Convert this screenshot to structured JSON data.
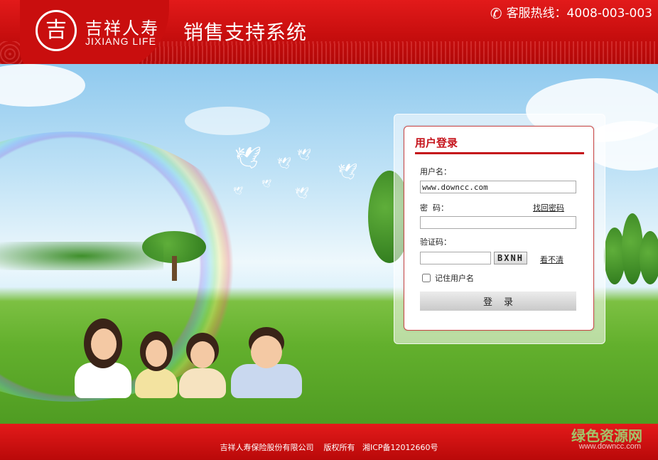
{
  "header": {
    "logo_glyph": "吉",
    "logo_cn": "吉祥人寿",
    "logo_en": "JIXIANG LIFE",
    "system_title": "销售支持系统",
    "hotline_icon": "phone-icon",
    "hotline": "客服热线：4008-003-003"
  },
  "login": {
    "title": "用户登录",
    "username_label": "用户名：",
    "username_value": "www.downcc.com",
    "password_label": "密  码：",
    "forgot_link": "找回密码",
    "captcha_label": "验证码：",
    "captcha_image_text": "BXNH",
    "refresh_link": "看不清",
    "remember_label": "记住用户名",
    "submit_label": "登录",
    "accent_color": "#c5131b"
  },
  "footer": {
    "copyright": "吉祥人寿保险股份有限公司    版权所有   湘ICP备12012660号"
  },
  "watermark": {
    "cn": "绿色资源网",
    "url": "www.downcc.com"
  }
}
